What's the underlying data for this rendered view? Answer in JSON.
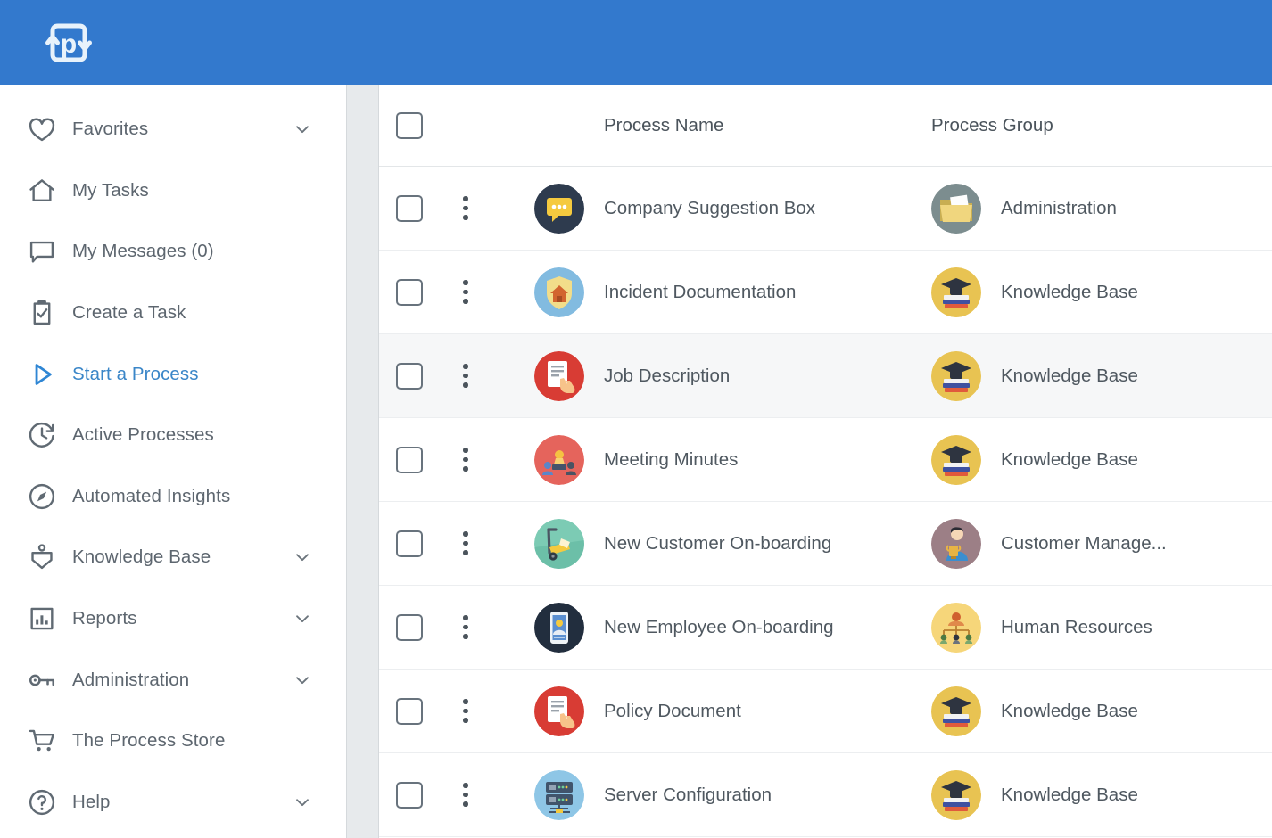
{
  "brand": {
    "logo_icon": "process-loop-logo-icon",
    "header_color": "#3379cd"
  },
  "sidebar": {
    "items": [
      {
        "label": "Favorites",
        "icon": "heart-icon",
        "chevron": true,
        "active": false
      },
      {
        "label": "My Tasks",
        "icon": "home-icon",
        "chevron": false,
        "active": false
      },
      {
        "label": "My Messages (0)",
        "icon": "message-icon",
        "chevron": false,
        "active": false
      },
      {
        "label": "Create a Task",
        "icon": "clipboard-check-icon",
        "chevron": false,
        "active": false
      },
      {
        "label": "Start a Process",
        "icon": "play-triangle-icon",
        "chevron": false,
        "active": true
      },
      {
        "label": "Active Processes",
        "icon": "clock-refresh-icon",
        "chevron": false,
        "active": false
      },
      {
        "label": "Automated Insights",
        "icon": "compass-icon",
        "chevron": false,
        "active": false
      },
      {
        "label": "Knowledge Base",
        "icon": "book-reader-icon",
        "chevron": true,
        "active": false
      },
      {
        "label": "Reports",
        "icon": "bar-chart-icon",
        "chevron": true,
        "active": false
      },
      {
        "label": "Administration",
        "icon": "key-icon",
        "chevron": true,
        "active": false
      },
      {
        "label": "The Process Store",
        "icon": "shopping-cart-icon",
        "chevron": false,
        "active": false
      },
      {
        "label": "Help",
        "icon": "question-circle-icon",
        "chevron": true,
        "active": false
      }
    ],
    "active_color": "#3a86c8"
  },
  "table": {
    "columns": {
      "process_name": "Process Name",
      "process_group": "Process Group"
    },
    "select_all_checkbox": "unchecked",
    "rows": [
      {
        "name": "Company Suggestion Box",
        "group": "Administration",
        "selected": false,
        "name_icon": "speech-bubble-icon",
        "name_icon_bg": "#2e3b4e",
        "group_icon": "folder-document-icon",
        "group_icon_bg": "#7c8d8f"
      },
      {
        "name": "Incident Documentation",
        "group": "Knowledge Base",
        "selected": false,
        "name_icon": "shield-house-icon",
        "name_icon_bg": "#82bbe0",
        "group_icon": "graduation-books-icon",
        "group_icon_bg": "#e8c352"
      },
      {
        "name": "Job Description",
        "group": "Knowledge Base",
        "selected": true,
        "name_icon": "document-hand-icon",
        "name_icon_bg": "#d83c34",
        "group_icon": "graduation-books-icon",
        "group_icon_bg": "#e8c352"
      },
      {
        "name": "Meeting Minutes",
        "group": "Knowledge Base",
        "selected": false,
        "name_icon": "meeting-people-icon",
        "name_icon_bg": "#e5645c",
        "group_icon": "graduation-books-icon",
        "group_icon_bg": "#e8c352"
      },
      {
        "name": "New Customer On-boarding",
        "group": "Customer Manage...",
        "selected": false,
        "name_icon": "hand-truck-icon",
        "name_icon_bg": "#7ccbb4",
        "group_icon": "person-trophy-icon",
        "group_icon_bg": "#9c7f86"
      },
      {
        "name": "New Employee On-boarding",
        "group": "Human Resources",
        "selected": false,
        "name_icon": "mobile-profile-icon",
        "name_icon_bg": "#222e3e",
        "group_icon": "org-chart-icon",
        "group_icon_bg": "#f6d67a"
      },
      {
        "name": "Policy Document",
        "group": "Knowledge Base",
        "selected": false,
        "name_icon": "document-hand-icon",
        "name_icon_bg": "#d83c34",
        "group_icon": "graduation-books-icon",
        "group_icon_bg": "#e8c352"
      },
      {
        "name": "Server Configuration",
        "group": "Knowledge Base",
        "selected": false,
        "name_icon": "server-rack-icon",
        "name_icon_bg": "#8ec6e6",
        "group_icon": "graduation-books-icon",
        "group_icon_bg": "#e8c352"
      }
    ]
  }
}
